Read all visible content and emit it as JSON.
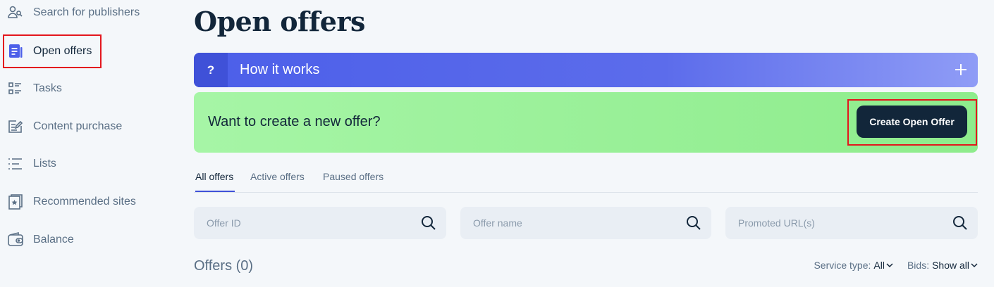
{
  "sidebar": {
    "items": [
      {
        "label": "Search for publishers",
        "icon": "users-search-icon"
      },
      {
        "label": "Open offers",
        "icon": "document-icon",
        "active": true
      },
      {
        "label": "Tasks",
        "icon": "tasks-list-icon"
      },
      {
        "label": "Content purchase",
        "icon": "edit-document-icon"
      },
      {
        "label": "Lists",
        "icon": "list-icon"
      },
      {
        "label": "Recommended sites",
        "icon": "star-bookmark-icon"
      },
      {
        "label": "Balance",
        "icon": "wallet-icon"
      }
    ]
  },
  "main": {
    "title": "Open offers",
    "how_it_works": {
      "badge": "?",
      "label": "How it works",
      "expand_icon": "plus-icon"
    },
    "create_banner": {
      "text": "Want to create a new offer?",
      "button_label": "Create Open Offer"
    },
    "tabs": [
      {
        "label": "All offers",
        "active": true
      },
      {
        "label": "Active offers",
        "active": false
      },
      {
        "label": "Paused offers",
        "active": false
      }
    ],
    "search": {
      "offer_id": {
        "placeholder": "Offer ID",
        "value": ""
      },
      "offer_name": {
        "placeholder": "Offer name",
        "value": ""
      },
      "promoted_url": {
        "placeholder": "Promoted URL(s)",
        "value": ""
      }
    },
    "offers_heading": "Offers (0)",
    "filters": {
      "service_type": {
        "label": "Service type:",
        "value": "All"
      },
      "bids": {
        "label": "Bids:",
        "value": "Show all"
      }
    }
  },
  "colors": {
    "accent": "#3f51d8",
    "dark": "#12263a",
    "muted": "#5a6f85",
    "banner_green": "#8eec8c",
    "highlight_red": "#e3161d"
  }
}
